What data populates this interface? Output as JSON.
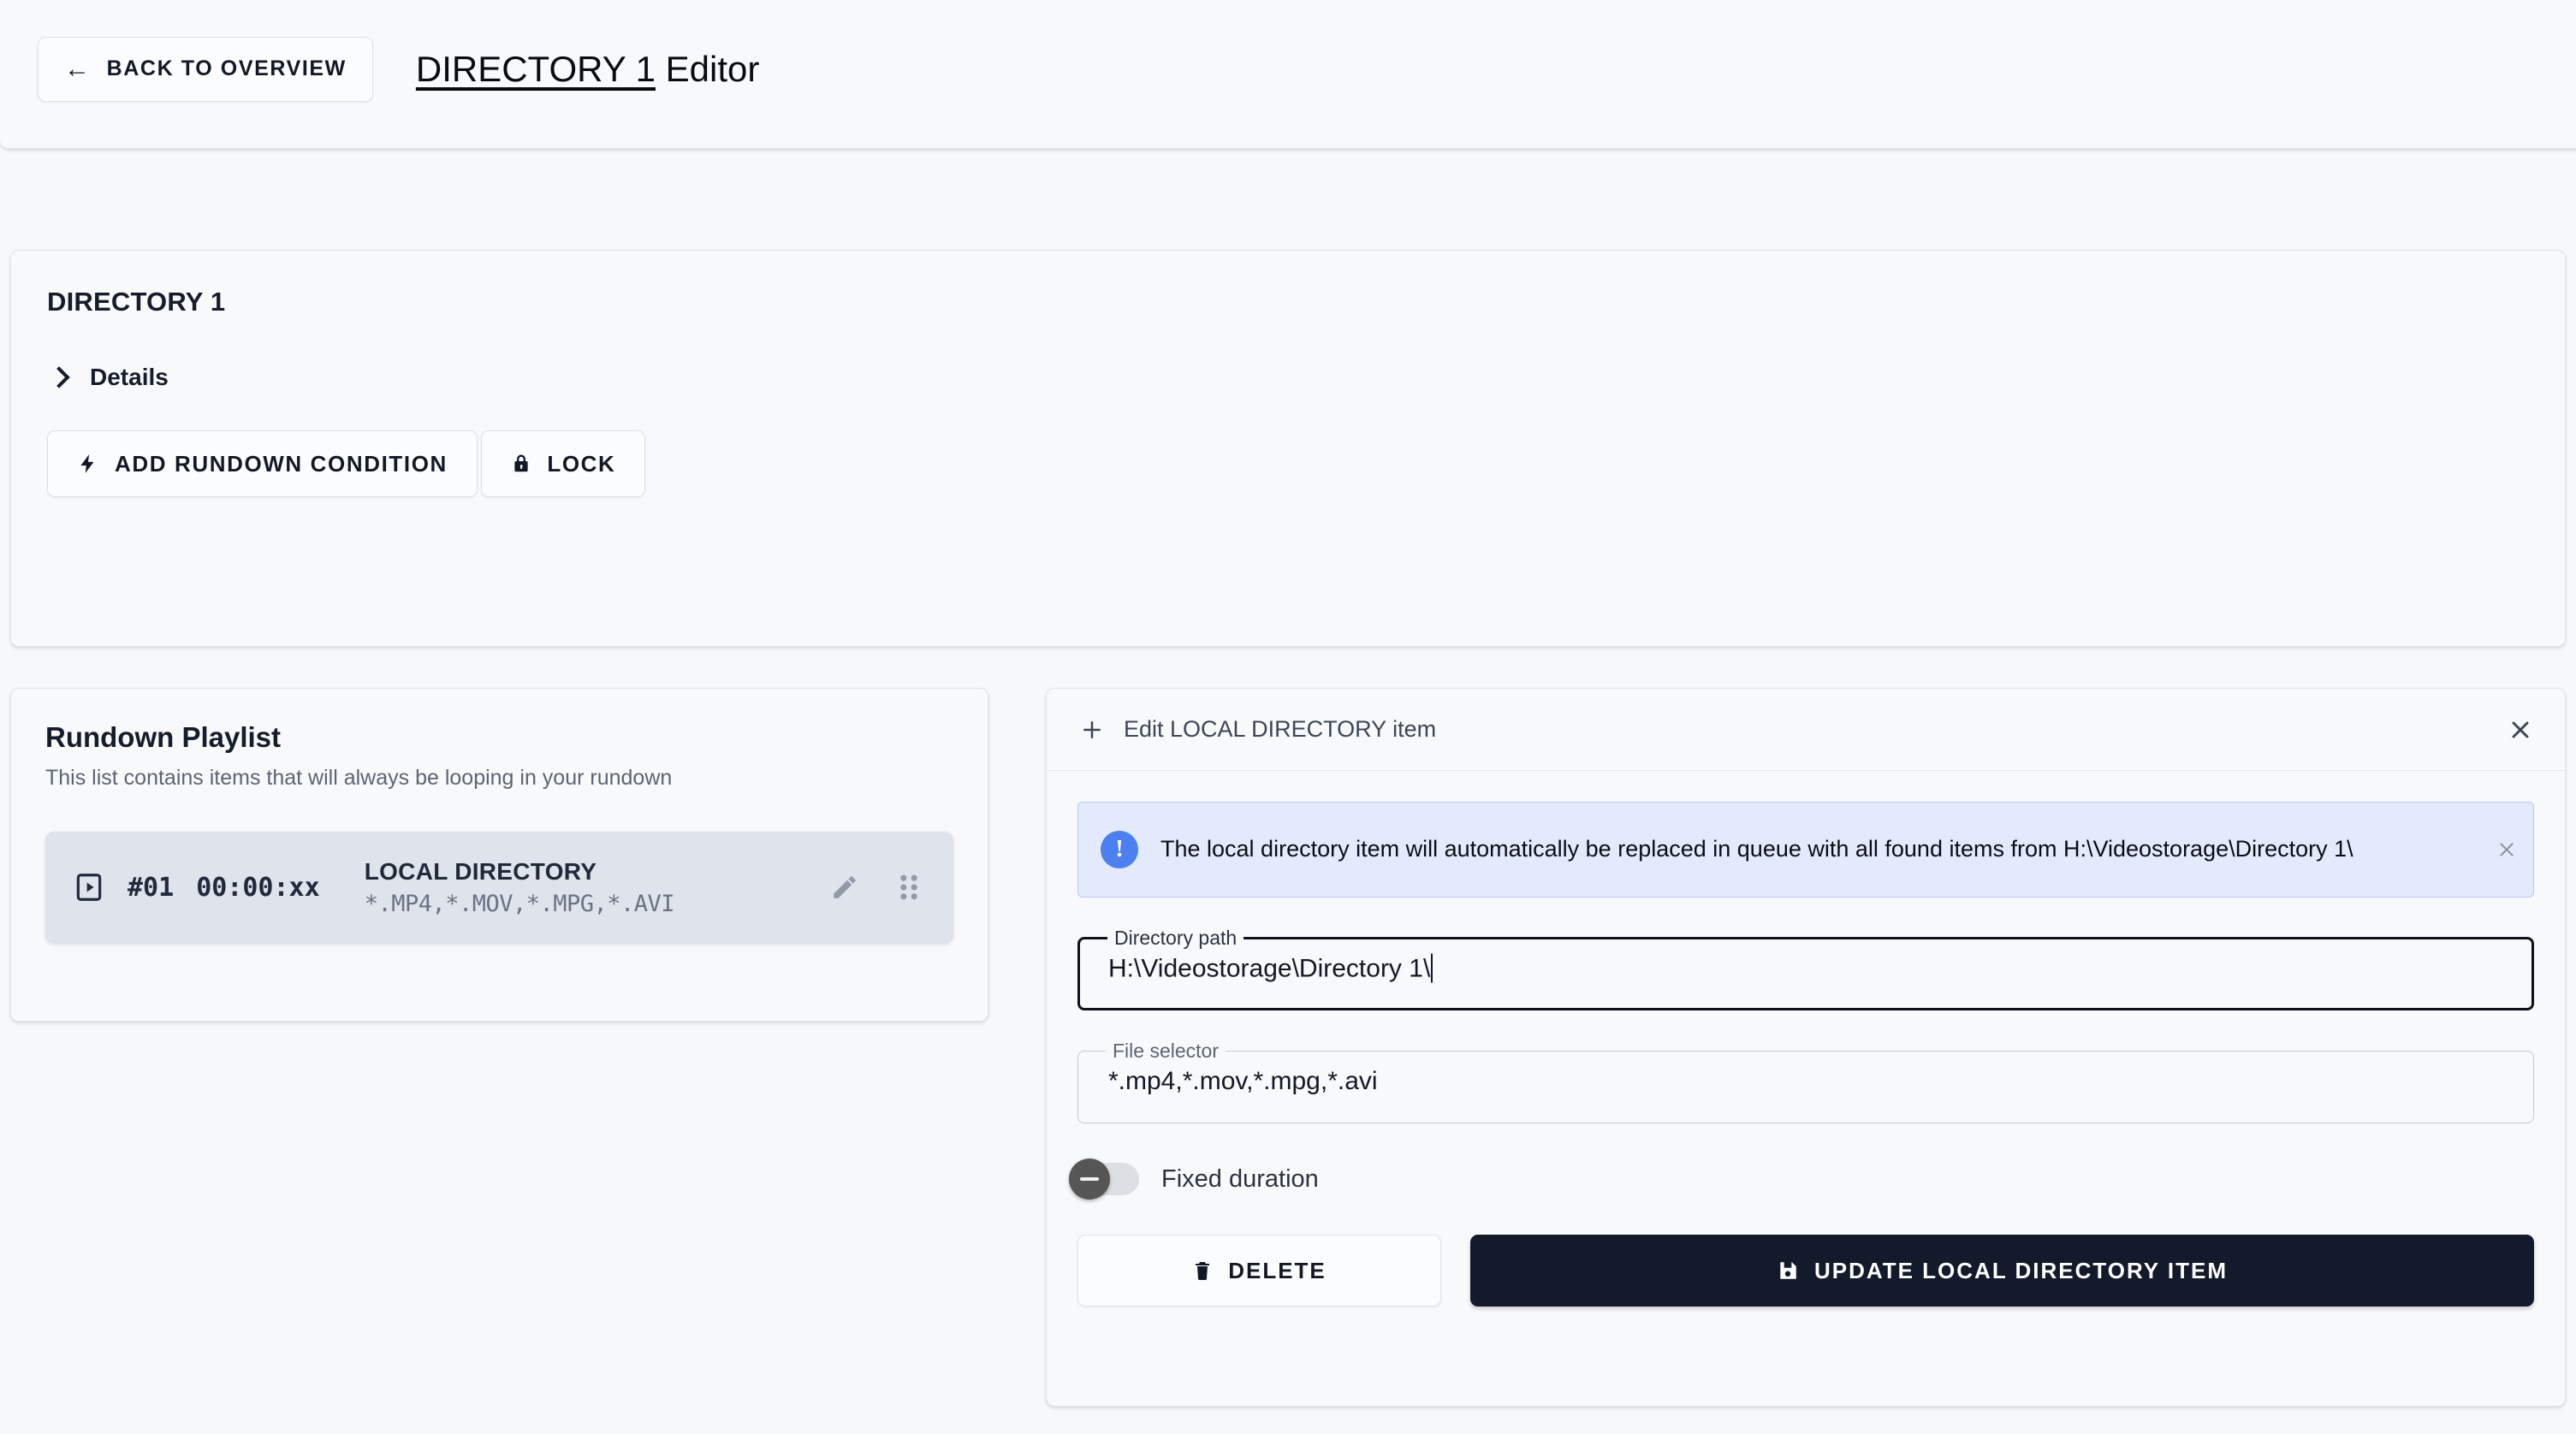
{
  "header": {
    "back_button": "BACK TO OVERVIEW",
    "back_icon": "arrow-left-icon",
    "title_highlight": "DIRECTORY 1",
    "title_rest": " Editor"
  },
  "section": {
    "title": "DIRECTORY 1",
    "details_label": "Details",
    "details_icon": "chevron-right-icon",
    "add_condition_label": "ADD RUNDOWN CONDITION",
    "add_condition_icon": "lightning-bolt-icon",
    "lock_label": "LOCK",
    "lock_icon": "lock-icon"
  },
  "playlist": {
    "title": "Rundown Playlist",
    "subtitle": "This list contains items that will always be looping in your rundown",
    "items": [
      {
        "type_icon": "play-rect-icon",
        "index": "#01",
        "duration": "00:00:xx",
        "name": "LOCAL DIRECTORY",
        "filter": "*.MP4,*.MOV,*.MPG,*.AVI",
        "edit_icon": "pencil-icon",
        "drag_icon": "drag-handle-icon"
      }
    ]
  },
  "editor": {
    "header_icon": "plus-icon",
    "header_title": "Edit LOCAL DIRECTORY item",
    "close_icon": "close-icon",
    "banner": {
      "icon": "info-exclamation-icon",
      "text": "The local directory item will automatically be replaced in queue with all found items from H:\\Videostorage\\Directory 1\\",
      "close_icon": "close-icon"
    },
    "directory_path": {
      "label": "Directory path",
      "value": "H:\\Videostorage\\Directory 1\\"
    },
    "file_selector": {
      "label": "File selector",
      "value": "*.mp4,*.mov,*.mpg,*.avi"
    },
    "fixed_duration": {
      "label": "Fixed duration",
      "state": "off"
    },
    "delete_label": "DELETE",
    "delete_icon": "trash-icon",
    "update_label": "UPDATE LOCAL DIRECTORY ITEM",
    "update_icon": "save-disk-icon"
  },
  "colors": {
    "accent_dark": "#121a2c",
    "info_blue": "#4c80ef",
    "info_bg": "#e3eafc",
    "item_bg": "#dfe3ec",
    "card_bg": "#f8f9fb"
  }
}
